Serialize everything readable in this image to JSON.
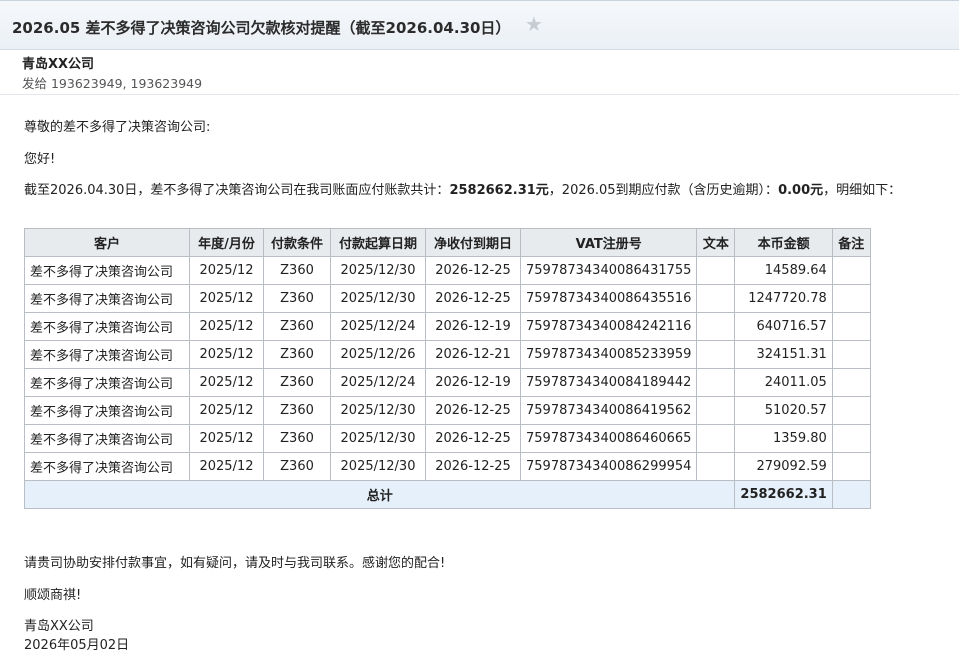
{
  "subject": {
    "title": "2026.05 差不多得了决策咨询公司欠款核对提醒（截至2026.04.30日）",
    "star_icon": "star-icon"
  },
  "header": {
    "sender": "青岛XX公司",
    "recipients": "发给 193623949, 193623949"
  },
  "body": {
    "greeting_to": "尊敬的差不多得了决策咨询公司:",
    "hello": "您好!",
    "summary_prefix": "截至2026.04.30日，差不多得了决策咨询公司在我司账面应付账款共计：",
    "summary_total": "2582662.31元",
    "summary_mid": "，2026.05到期应付款（含历史逾期）：",
    "summary_due": "0.00元",
    "summary_suffix": "，明细如下：",
    "closing_request": "请贵司协助安排付款事宜，如有疑问，请及时与我司联系。感谢您的配合!",
    "regards": "顺颂商祺!",
    "signature_company": "青岛XX公司",
    "signature_date": "2026年05月02日"
  },
  "table": {
    "headers": [
      "客户",
      "年度/月份",
      "付款条件",
      "付款起算日期",
      "净收付到期日",
      "VAT注册号",
      "文本",
      "本币金额",
      "备注"
    ],
    "rows": [
      [
        "差不多得了决策咨询公司",
        "2025/12",
        "Z360",
        "2025/12/30",
        "2026-12-25",
        "75978734340086431755",
        "",
        "14589.64",
        ""
      ],
      [
        "差不多得了决策咨询公司",
        "2025/12",
        "Z360",
        "2025/12/30",
        "2026-12-25",
        "75978734340086435516",
        "",
        "1247720.78",
        ""
      ],
      [
        "差不多得了决策咨询公司",
        "2025/12",
        "Z360",
        "2025/12/24",
        "2026-12-19",
        "75978734340084242116",
        "",
        "640716.57",
        ""
      ],
      [
        "差不多得了决策咨询公司",
        "2025/12",
        "Z360",
        "2025/12/26",
        "2026-12-21",
        "75978734340085233959",
        "",
        "324151.31",
        ""
      ],
      [
        "差不多得了决策咨询公司",
        "2025/12",
        "Z360",
        "2025/12/24",
        "2026-12-19",
        "75978734340084189442",
        "",
        "24011.05",
        ""
      ],
      [
        "差不多得了决策咨询公司",
        "2025/12",
        "Z360",
        "2025/12/30",
        "2026-12-25",
        "75978734340086419562",
        "",
        "51020.57",
        ""
      ],
      [
        "差不多得了决策咨询公司",
        "2025/12",
        "Z360",
        "2025/12/30",
        "2026-12-25",
        "75978734340086460665",
        "",
        "1359.80",
        ""
      ],
      [
        "差不多得了决策咨询公司",
        "2025/12",
        "Z360",
        "2025/12/30",
        "2026-12-25",
        "75978734340086299954",
        "",
        "279092.59",
        ""
      ]
    ],
    "total_label": "总计",
    "total_value": "2582662.31"
  }
}
